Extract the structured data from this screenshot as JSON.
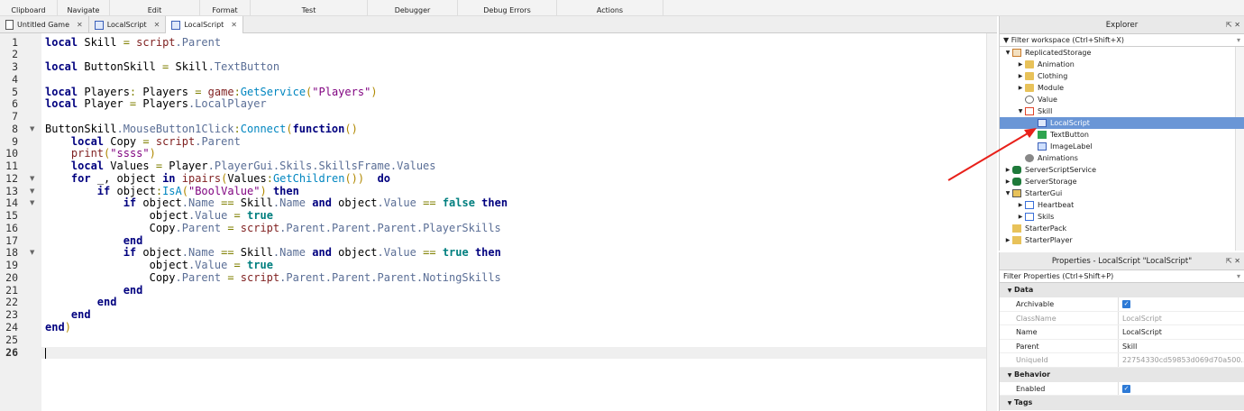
{
  "ribbon": [
    "Clipboard",
    "Navigate",
    "Edit",
    "Format",
    "Test",
    "Debugger",
    "Debug Errors",
    "Actions"
  ],
  "tabs": [
    {
      "label": "Untitled Game",
      "icon": "game"
    },
    {
      "label": "LocalScript",
      "icon": "script"
    },
    {
      "label": "LocalScript",
      "icon": "script",
      "active": true
    }
  ],
  "editor": {
    "current_line": 26,
    "folds": [
      8,
      12,
      13,
      14,
      18
    ],
    "lines": [
      [
        [
          "k",
          "local"
        ],
        [
          "i",
          " Skill "
        ],
        [
          "o",
          "="
        ],
        [
          "i",
          " "
        ],
        [
          "b",
          "script"
        ],
        [
          "p",
          ".Parent"
        ]
      ],
      [],
      [
        [
          "k",
          "local"
        ],
        [
          "i",
          " ButtonSkill "
        ],
        [
          "o",
          "="
        ],
        [
          "i",
          " Skill"
        ],
        [
          "p",
          ".TextButton"
        ]
      ],
      [],
      [
        [
          "k",
          "local"
        ],
        [
          "i",
          " Players"
        ],
        [
          "o",
          ":"
        ],
        [
          "i",
          " Players "
        ],
        [
          "o",
          "="
        ],
        [
          "i",
          " "
        ],
        [
          "b",
          "game"
        ],
        [
          "o",
          ":"
        ],
        [
          "m",
          "GetService"
        ],
        [
          "r",
          "("
        ],
        [
          "s",
          "\"Players\""
        ],
        [
          "r",
          ")"
        ]
      ],
      [
        [
          "k",
          "local"
        ],
        [
          "i",
          " Player "
        ],
        [
          "o",
          "="
        ],
        [
          "i",
          " Players"
        ],
        [
          "p",
          ".LocalPlayer"
        ]
      ],
      [],
      [
        [
          "i",
          "ButtonSkill"
        ],
        [
          "p",
          ".MouseButton1Click"
        ],
        [
          "o",
          ":"
        ],
        [
          "m",
          "Connect"
        ],
        [
          "r",
          "("
        ],
        [
          "k",
          "function"
        ],
        [
          "r",
          "()"
        ]
      ],
      [
        [
          "i",
          "    "
        ],
        [
          "k",
          "local"
        ],
        [
          "i",
          " Copy "
        ],
        [
          "o",
          "="
        ],
        [
          "i",
          " "
        ],
        [
          "b",
          "script"
        ],
        [
          "p",
          ".Parent"
        ]
      ],
      [
        [
          "i",
          "    "
        ],
        [
          "b",
          "print"
        ],
        [
          "r",
          "("
        ],
        [
          "s",
          "\"ssss\""
        ],
        [
          "r",
          ")"
        ]
      ],
      [
        [
          "i",
          "    "
        ],
        [
          "k",
          "local"
        ],
        [
          "i",
          " Values "
        ],
        [
          "o",
          "="
        ],
        [
          "i",
          " Player"
        ],
        [
          "p",
          ".PlayerGui.Skils.SkillsFrame.Values"
        ]
      ],
      [
        [
          "i",
          "    "
        ],
        [
          "k",
          "for"
        ],
        [
          "i",
          " _, object "
        ],
        [
          "k",
          "in"
        ],
        [
          "i",
          " "
        ],
        [
          "b",
          "ipairs"
        ],
        [
          "r",
          "("
        ],
        [
          "i",
          "Values"
        ],
        [
          "o",
          ":"
        ],
        [
          "m",
          "GetChildren"
        ],
        [
          "r",
          "())"
        ],
        [
          "i",
          "  "
        ],
        [
          "k",
          "do"
        ]
      ],
      [
        [
          "i",
          "        "
        ],
        [
          "k",
          "if"
        ],
        [
          "i",
          " object"
        ],
        [
          "o",
          ":"
        ],
        [
          "m",
          "IsA"
        ],
        [
          "r",
          "("
        ],
        [
          "s",
          "\"BoolValue\""
        ],
        [
          "r",
          ")"
        ],
        [
          "i",
          " "
        ],
        [
          "k",
          "then"
        ]
      ],
      [
        [
          "i",
          "            "
        ],
        [
          "k",
          "if"
        ],
        [
          "i",
          " object"
        ],
        [
          "p",
          ".Name"
        ],
        [
          "i",
          " "
        ],
        [
          "o",
          "=="
        ],
        [
          "i",
          " Skill"
        ],
        [
          "p",
          ".Name"
        ],
        [
          "i",
          " "
        ],
        [
          "k",
          "and"
        ],
        [
          "i",
          " object"
        ],
        [
          "p",
          ".Value"
        ],
        [
          "i",
          " "
        ],
        [
          "o",
          "=="
        ],
        [
          "i",
          " "
        ],
        [
          "t",
          "false"
        ],
        [
          "i",
          " "
        ],
        [
          "k",
          "then"
        ]
      ],
      [
        [
          "i",
          "                object"
        ],
        [
          "p",
          ".Value"
        ],
        [
          "i",
          " "
        ],
        [
          "o",
          "="
        ],
        [
          "i",
          " "
        ],
        [
          "t",
          "true"
        ]
      ],
      [
        [
          "i",
          "                Copy"
        ],
        [
          "p",
          ".Parent"
        ],
        [
          "i",
          " "
        ],
        [
          "o",
          "="
        ],
        [
          "i",
          " "
        ],
        [
          "b",
          "script"
        ],
        [
          "p",
          ".Parent.Parent.Parent.PlayerSkills"
        ]
      ],
      [
        [
          "i",
          "            "
        ],
        [
          "k",
          "end"
        ]
      ],
      [
        [
          "i",
          "            "
        ],
        [
          "k",
          "if"
        ],
        [
          "i",
          " object"
        ],
        [
          "p",
          ".Name"
        ],
        [
          "i",
          " "
        ],
        [
          "o",
          "=="
        ],
        [
          "i",
          " Skill"
        ],
        [
          "p",
          ".Name"
        ],
        [
          "i",
          " "
        ],
        [
          "k",
          "and"
        ],
        [
          "i",
          " object"
        ],
        [
          "p",
          ".Value"
        ],
        [
          "i",
          " "
        ],
        [
          "o",
          "=="
        ],
        [
          "i",
          " "
        ],
        [
          "t",
          "true"
        ],
        [
          "i",
          " "
        ],
        [
          "k",
          "then"
        ]
      ],
      [
        [
          "i",
          "                object"
        ],
        [
          "p",
          ".Value"
        ],
        [
          "i",
          " "
        ],
        [
          "o",
          "="
        ],
        [
          "i",
          " "
        ],
        [
          "t",
          "true"
        ]
      ],
      [
        [
          "i",
          "                Copy"
        ],
        [
          "p",
          ".Parent"
        ],
        [
          "i",
          " "
        ],
        [
          "o",
          "="
        ],
        [
          "i",
          " "
        ],
        [
          "b",
          "script"
        ],
        [
          "p",
          ".Parent.Parent.Parent.NotingSkills"
        ]
      ],
      [
        [
          "i",
          "            "
        ],
        [
          "k",
          "end"
        ]
      ],
      [
        [
          "i",
          "        "
        ],
        [
          "k",
          "end"
        ]
      ],
      [
        [
          "i",
          "    "
        ],
        [
          "k",
          "end"
        ]
      ],
      [
        [
          "k",
          "end"
        ],
        [
          "r",
          ")"
        ]
      ],
      [],
      []
    ]
  },
  "explorer": {
    "title": "Explorer",
    "filter": "Filter workspace (Ctrl+Shift+X)",
    "items": [
      {
        "label": "ReplicatedStorage",
        "depth": 0,
        "exp": "open",
        "icon": "ico-rs"
      },
      {
        "label": "Animation",
        "depth": 1,
        "exp": "closed",
        "icon": "folder"
      },
      {
        "label": "Clothing",
        "depth": 1,
        "exp": "closed",
        "icon": "folder"
      },
      {
        "label": "Module",
        "depth": 1,
        "exp": "closed",
        "icon": "folder"
      },
      {
        "label": "Value",
        "depth": 1,
        "exp": "",
        "icon": "ico-val"
      },
      {
        "label": "Skill",
        "depth": 1,
        "exp": "open",
        "icon": "ico-frame"
      },
      {
        "label": "LocalScript",
        "depth": 2,
        "exp": "",
        "icon": "ico-script",
        "selected": true
      },
      {
        "label": "TextButton",
        "depth": 2,
        "exp": "",
        "icon": "ico-tb"
      },
      {
        "label": "ImageLabel",
        "depth": 2,
        "exp": "",
        "icon": "ico-img"
      },
      {
        "label": "Animations",
        "depth": 1,
        "exp": "",
        "icon": "ico-anim"
      },
      {
        "label": "ServerScriptService",
        "depth": 0,
        "exp": "closed",
        "icon": "ico-sss"
      },
      {
        "label": "ServerStorage",
        "depth": 0,
        "exp": "closed",
        "icon": "ico-sss"
      },
      {
        "label": "StarterGui",
        "depth": 0,
        "exp": "open",
        "icon": "ico-gui"
      },
      {
        "label": "Heartbeat",
        "depth": 1,
        "exp": "closed",
        "icon": "ico-sg"
      },
      {
        "label": "Skils",
        "depth": 1,
        "exp": "closed",
        "icon": "ico-sg"
      },
      {
        "label": "StarterPack",
        "depth": 0,
        "exp": "",
        "icon": "ico-pack"
      },
      {
        "label": "StarterPlayer",
        "depth": 0,
        "exp": "closed",
        "icon": "ico-pack"
      }
    ]
  },
  "properties": {
    "title": "Properties - LocalScript \"LocalScript\"",
    "filter": "Filter Properties (Ctrl+Shift+P)",
    "sections": [
      {
        "name": "Data",
        "rows": [
          {
            "name": "Archivable",
            "checkbox": true
          },
          {
            "name": "ClassName",
            "value": "LocalScript",
            "readonly": true
          },
          {
            "name": "Name",
            "value": "LocalScript"
          },
          {
            "name": "Parent",
            "value": "Skill"
          },
          {
            "name": "UniqueId",
            "value": "22754330cd59853d069d70a500...",
            "readonly": true
          }
        ]
      },
      {
        "name": "Behavior",
        "rows": [
          {
            "name": "Enabled",
            "checkbox": true
          }
        ]
      },
      {
        "name": "Tags",
        "rows": []
      }
    ]
  },
  "colors": {
    "selection": "#6a96d6",
    "annotation_arrow": "#e8201a"
  }
}
